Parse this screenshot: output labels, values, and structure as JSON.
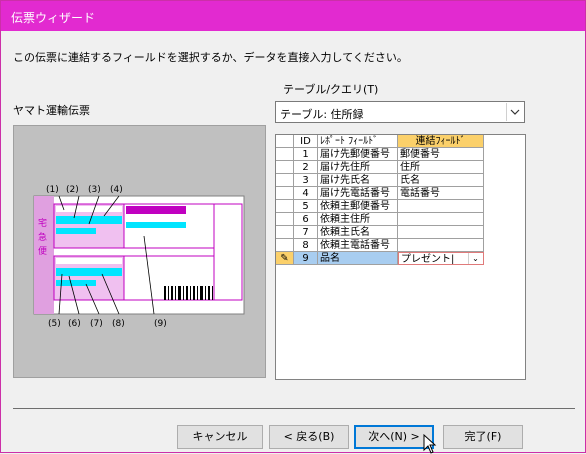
{
  "window": {
    "title": "伝票ウィザード"
  },
  "instruction": "この伝票に連結するフィールドを選択するか、データを直接入力してください。",
  "slip": {
    "name": "ヤマト運輸伝票",
    "stamp": "宅急便",
    "callouts_top": [
      "(1)",
      "(2)",
      "(3)",
      "(4)"
    ],
    "callouts_bottom": [
      "(5)",
      "(6)",
      "(7)",
      "(8)",
      "(9)"
    ]
  },
  "table_query": {
    "label": "テーブル/クエリ(T)",
    "selected": "テーブル: 住所録"
  },
  "grid": {
    "headers": [
      "",
      "ID",
      "ﾚﾎﾟｰﾄ ﾌｨｰﾙﾄﾞ",
      "連結ﾌｨｰﾙﾄﾞ"
    ],
    "rows": [
      {
        "marker": "",
        "id": "1",
        "report_field": "届け先郵便番号",
        "linked_field": "郵便番号"
      },
      {
        "marker": "",
        "id": "2",
        "report_field": "届け先住所",
        "linked_field": "住所"
      },
      {
        "marker": "",
        "id": "3",
        "report_field": "届け先氏名",
        "linked_field": "氏名"
      },
      {
        "marker": "",
        "id": "4",
        "report_field": "届け先電話番号",
        "linked_field": "電話番号"
      },
      {
        "marker": "",
        "id": "5",
        "report_field": "依頼主郵便番号",
        "linked_field": ""
      },
      {
        "marker": "",
        "id": "6",
        "report_field": "依頼主住所",
        "linked_field": ""
      },
      {
        "marker": "",
        "id": "7",
        "report_field": "依頼主氏名",
        "linked_field": ""
      },
      {
        "marker": "",
        "id": "8",
        "report_field": "依頼主電話番号",
        "linked_field": ""
      },
      {
        "marker": "pencil",
        "id": "9",
        "report_field": "品名",
        "linked_field": "プレゼント|"
      }
    ],
    "selected_row": 9
  },
  "buttons": {
    "cancel": "キャンセル",
    "back": "< 戻る(B)",
    "next": "次へ(N) >",
    "finish": "完了(F)"
  },
  "colors": {
    "title_bar": "#e22ad0",
    "slip_magenta": "#c000c0",
    "slip_cyan": "#00e5ff",
    "selected_row": "#a8cdf0",
    "selected_header": "#fbd06a"
  },
  "icons": {
    "combo_arrow": "chevron-down-icon",
    "edit_row": "pencil-icon",
    "cell_dropdown": "chevron-down-icon",
    "mouse": "cursor-icon"
  }
}
